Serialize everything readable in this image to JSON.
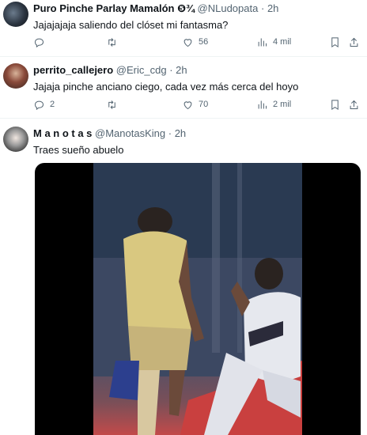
{
  "replies": [
    {
      "name": "Puro Pinche Parlay Mamalón ❺¾",
      "handle": "@NLudopata",
      "time": "2h",
      "text": "Jajajajaja saliendo del clóset mi fantasma?",
      "reply_count": "",
      "retweet_count": "",
      "like_count": "56",
      "view_count": "4 mil"
    },
    {
      "name": "perrito_callejero",
      "handle": "@Eric_cdg",
      "time": "2h",
      "text": "Jajaja pinche anciano ciego, cada vez más cerca del hoyo",
      "reply_count": "2",
      "retweet_count": "",
      "like_count": "70",
      "view_count": "2 mil"
    },
    {
      "name": "M a n o t a s",
      "handle": "@ManotasKing",
      "time": "2h",
      "text": "Traes sueño abuelo"
    }
  ],
  "icons": {
    "reply": "comment-icon",
    "retweet": "retweet-icon",
    "like": "heart-icon",
    "views": "views-icon",
    "bookmark": "bookmark-icon",
    "share": "share-icon"
  },
  "colors": {
    "text": "#0f1419",
    "muted": "#536471",
    "divider": "#eff3f4",
    "media_bg": "#000000"
  }
}
